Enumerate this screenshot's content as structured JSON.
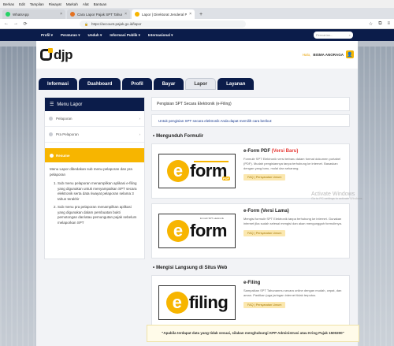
{
  "browser": {
    "menu": [
      "Berkas",
      "Edit",
      "Tampilan",
      "Riwayat",
      "Markah",
      "Alat",
      "Bantuan"
    ],
    "tabs": [
      {
        "label": "WhatsApp",
        "favicon_color": "#25d366"
      },
      {
        "label": "Cara Lapor Pajak SPT Tahunan",
        "favicon_color": "#e37222"
      },
      {
        "label": "Lapor | Direktorat Jenderal Pajak",
        "favicon_color": "#f7b500"
      }
    ],
    "new_tab": "+",
    "url": "https://account.pajak.go.id/lapor"
  },
  "site_nav": {
    "items": [
      "Profil ▾",
      "Peraturan ▾",
      "Unduh ▾",
      "Informasi Publik ▾",
      "Internasional ▾"
    ],
    "search_placeholder": "Pencarian..."
  },
  "header": {
    "logo_text": "djp",
    "greeting": "Halo,",
    "user_name": "BISMA ANORAGA"
  },
  "page_tabs": [
    "Informasi",
    "Dashboard",
    "Profil",
    "Bayar",
    "Lapor",
    "Layanan"
  ],
  "active_tab": "Lapor",
  "sidebar": {
    "title": "Menu Lapor",
    "items": [
      "Pelaporan",
      "Pra Pelaporan"
    ],
    "resume_label": "Resume",
    "intro": "Menu Lapor dibedakan sub menu pelaporan dan pra pelaporan",
    "list": [
      "Sub menu pelaporan menampilkan aplikasi e-filing yang digunakan untuk menyampaikan SPT secara elektronik serta data riwayat pelaporan selama 3 tahun terakhir",
      "Sub menu pra pelaporan menampilkan aplikasi yang digunakan dalam pembuatan bukti pemotongan dan/atau pemungutan pajak sebelum melaporkan SPT"
    ]
  },
  "main": {
    "card_title": "Pengisian SPT Secara Elektronik (e-Filing)",
    "intro": "Untuk pengisian SPT secara elektronik Anda dapat memilih cara berikut:",
    "section_download": "Mengunduh Formulir",
    "section_direct": "Mengisi Langsung di Situs Web",
    "forms": [
      {
        "name": "e-Form PDF ",
        "name_accent": "(Versi Baru)",
        "desc": "Formulir SPT Elektronik versi terbaru dalam format dokumen portabel (PDF). Mudah pengisiannya tanpa terhubung ke internet. Basaskan dengan yang baru, mulai dan sekarang.",
        "button": "FAQ | Persyaratan Umum",
        "logo_word": "form",
        "logo_letter": "e",
        "logo_badge": "PDF",
        "logo_tag": ""
      },
      {
        "name": "e-Form (Versi Lama)",
        "name_accent": "",
        "desc": "Mengisi formulir SPT Elektronik tanpa terhubung ke internet. Gunakan internet jika sudah selesai mengisi dan akan mengunggah formulirnya.",
        "button": "FAQ | Persyaratan Umum",
        "logo_word": "form",
        "logo_letter": "e",
        "logo_badge": "",
        "logo_tag": "formulir SPT elektronik"
      },
      {
        "name": "e-Filing",
        "name_accent": "",
        "desc": "Sampaikan SPT Tahunanmu secara online dengan mudah, cepat, dan aman. Pastikan juga jaringan internet tidak terputus.",
        "button": "FAQ | Persyaratan Umum",
        "logo_word": "filing",
        "logo_letter": "e",
        "logo_badge": "",
        "logo_tag": ""
      }
    ]
  },
  "toast": "\"Apabila terdapat data yang tidak sesuai, silakan menghubungi KPP Administrasi atau Kring Pajak 1500200\"",
  "watermark": {
    "title": "Activate Windows",
    "sub": "Go to PC settings to activate Windows."
  },
  "colors": {
    "navy": "#0b1c4a",
    "accent_yellow": "#f7b500",
    "link_blue": "#1a3b8f"
  }
}
